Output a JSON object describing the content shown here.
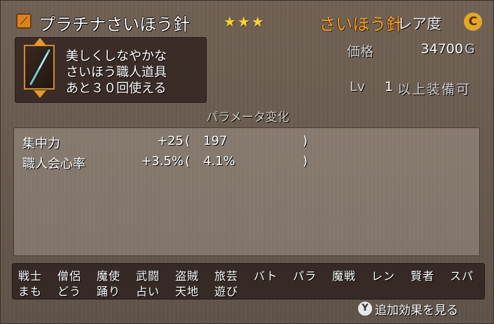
{
  "header": {
    "title": "プラチナさいほう針",
    "stars": "★★★",
    "category": "さいほう針",
    "rarity_label": "レア度",
    "rarity_grade": "C"
  },
  "info": {
    "description": [
      "美しくしなやかな",
      "さいほう職人道具",
      "あと３０回使える"
    ]
  },
  "stats": {
    "price_label": "価格",
    "price_value": "34700",
    "price_unit": "G",
    "lv_label": "Lv",
    "lv_value": "1",
    "lv_suffix": "以上装備可"
  },
  "params": {
    "title": "パラメータ変化",
    "rows": [
      {
        "name": "集中力",
        "delta": "+25",
        "open": "(",
        "value": "197",
        "close": ")"
      },
      {
        "name": "職人会心率",
        "delta": "+3.5%",
        "open": "(",
        "value": "4.1%",
        "close": ")"
      }
    ]
  },
  "jobs": {
    "row1": [
      "戦士",
      "僧侶",
      "魔使",
      "武闘",
      "盗賊",
      "旅芸",
      "バト",
      "パラ",
      "魔戦",
      "レン",
      "賢者",
      "スパ"
    ],
    "row2": [
      "まも",
      "どう",
      "踊り",
      "占い",
      "天地",
      "遊び"
    ]
  },
  "footer": {
    "button": "Y",
    "hint": "追加効果を見る"
  },
  "colors": {
    "title": "#ffffff",
    "category": "#f2a22c",
    "stars": "#f4d23a",
    "rarity_badge": "#e3a628"
  }
}
